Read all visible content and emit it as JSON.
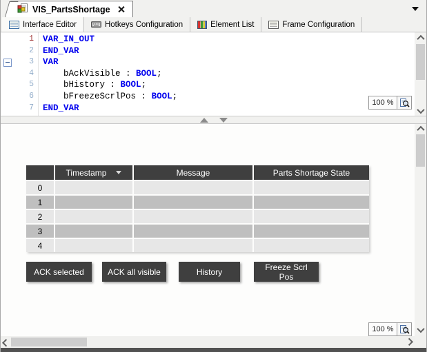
{
  "document_tab": {
    "title": "VIS_PartsShortage"
  },
  "tab_overflow_icon": "dropdown-arrow",
  "sub_tabs": [
    {
      "label": "Interface Editor",
      "icon": "form-editor-icon",
      "active": true
    },
    {
      "label": "Hotkeys Configuration",
      "icon": "keyboard-icon",
      "active": false
    },
    {
      "label": "Element List",
      "icon": "colored-table-icon",
      "active": false
    },
    {
      "label": "Frame Configuration",
      "icon": "frame-icon",
      "active": false
    }
  ],
  "editor": {
    "zoom_label": "100 %",
    "lines": [
      {
        "num": "1",
        "current": true,
        "tokens": [
          {
            "t": "VAR_IN_OUT",
            "k": "kw"
          }
        ]
      },
      {
        "num": "2",
        "tokens": [
          {
            "t": "END_VAR",
            "k": "kw"
          }
        ]
      },
      {
        "num": "3",
        "fold": true,
        "tokens": [
          {
            "t": "VAR",
            "k": "kw"
          }
        ]
      },
      {
        "num": "4",
        "tokens": [
          {
            "t": "    ",
            "k": "pl"
          },
          {
            "t": "bAckVisible",
            "k": "id"
          },
          {
            "t": " : ",
            "k": "pl"
          },
          {
            "t": "BOOL",
            "k": "kw"
          },
          {
            "t": ";",
            "k": "pl"
          }
        ]
      },
      {
        "num": "5",
        "tokens": [
          {
            "t": "    ",
            "k": "pl"
          },
          {
            "t": "bHistory",
            "k": "id"
          },
          {
            "t": " : ",
            "k": "pl"
          },
          {
            "t": "BOOL",
            "k": "kw"
          },
          {
            "t": ";",
            "k": "pl"
          }
        ]
      },
      {
        "num": "6",
        "tokens": [
          {
            "t": "    ",
            "k": "pl"
          },
          {
            "t": "bFreezeScrlPos",
            "k": "id"
          },
          {
            "t": " : ",
            "k": "pl"
          },
          {
            "t": "BOOL",
            "k": "kw"
          },
          {
            "t": ";",
            "k": "pl"
          }
        ]
      },
      {
        "num": "7",
        "tokens": [
          {
            "t": "END_VAR",
            "k": "kw"
          }
        ]
      }
    ]
  },
  "visualization": {
    "table": {
      "columns": [
        "",
        "Timestamp",
        "Message",
        "Parts Shortage State"
      ],
      "sort_column": "Timestamp",
      "rows": [
        "0",
        "1",
        "2",
        "3",
        "4"
      ]
    },
    "buttons": [
      {
        "label": "ACK selected",
        "name": "ack-selected-button"
      },
      {
        "label": "ACK all visible",
        "name": "ack-all-visible-button"
      },
      {
        "label": "History",
        "name": "history-button"
      },
      {
        "label": "Freeze Scrl Pos",
        "name": "freeze-scrl-pos-button"
      }
    ],
    "zoom_label": "100 %"
  },
  "colors": {
    "keyword": "#0000ee",
    "line_number": "#94aecb",
    "current_line_number": "#a33b3b",
    "table_header_bg": "#3f3f3f",
    "row_light": "#e7e7e7",
    "row_dark": "#bfbfbf",
    "button_bg": "#3f3f3f"
  }
}
